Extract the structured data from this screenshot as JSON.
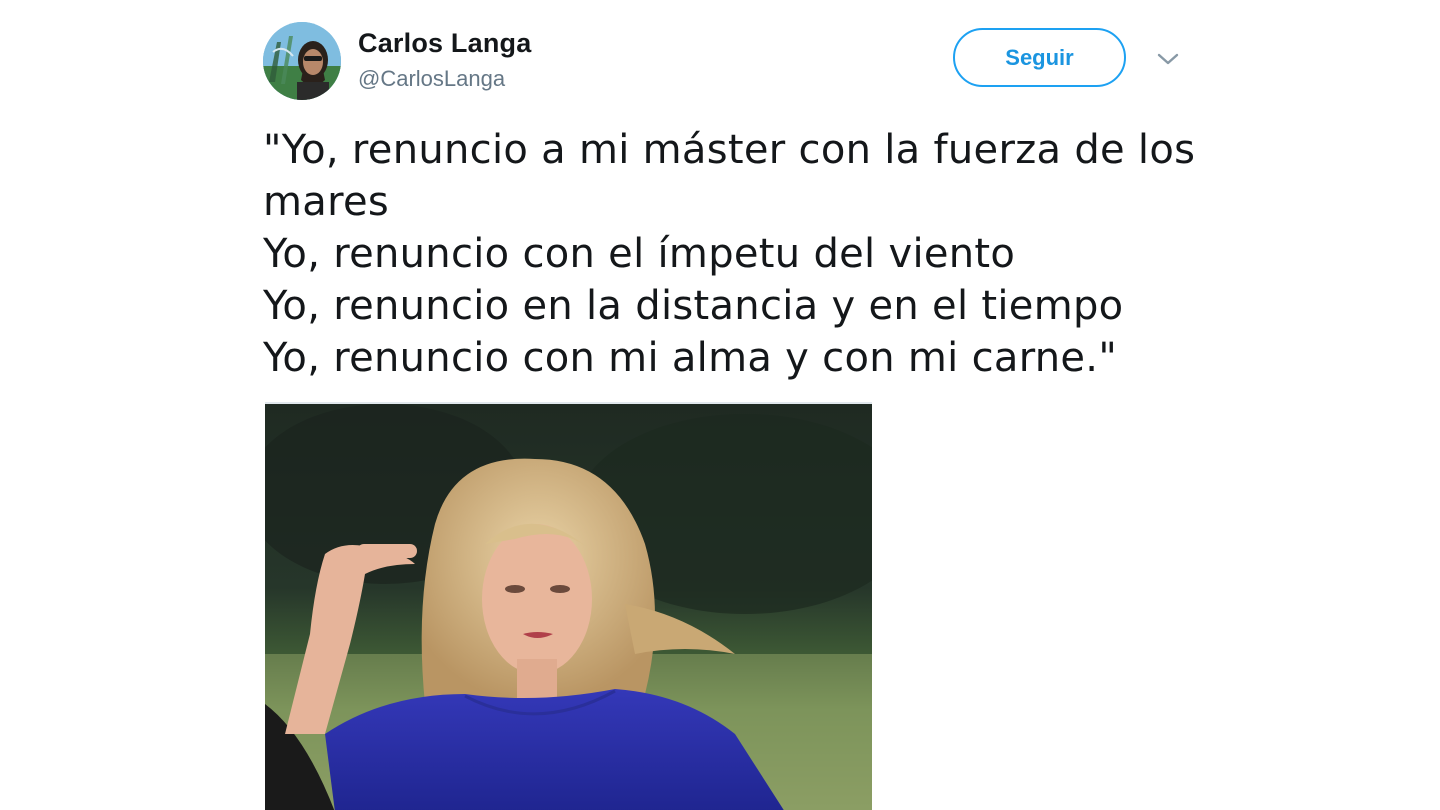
{
  "tweet": {
    "author_name": "Carlos Langa",
    "author_handle": "@CarlosLanga",
    "follow_label": "Seguir",
    "text_lines": [
      "\"Yo, renuncio a mi máster con la fuerza de los",
      "mares",
      "Yo, renuncio con el ímpetu del viento",
      "Yo, renuncio en la distancia y en el tiempo",
      "Yo, renuncio con mi alma y con mi carne.\""
    ]
  },
  "icons": {
    "menu": "chevron-down-icon",
    "avatar": "profile-photo",
    "media": "woman-in-blue-photo"
  },
  "colors": {
    "accent": "#1da1f2",
    "accent_text": "#1b95e0",
    "name": "#14171a",
    "handle": "#657786"
  }
}
